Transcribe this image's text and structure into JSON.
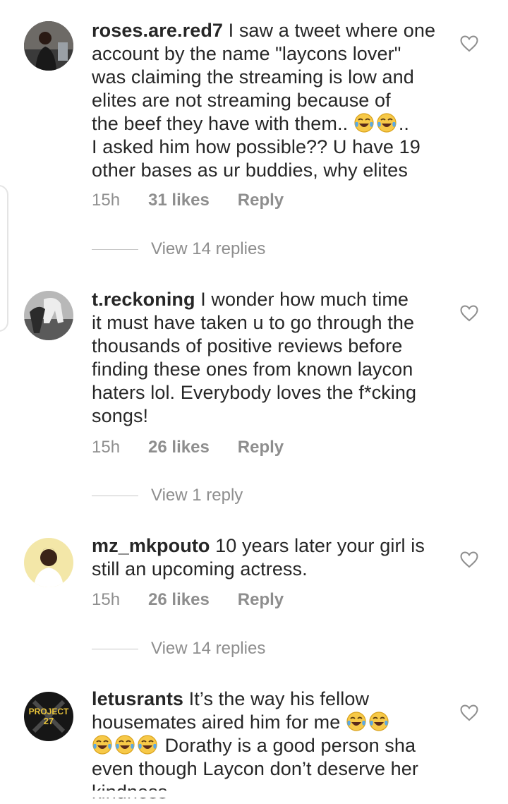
{
  "comments": [
    {
      "username": "roses.are.red7",
      "text_lines": [
        " I saw a tweet where one",
        "account by the name \"laycons lover\"",
        "was claiming the streaming is low and",
        "elites are not streaming because of",
        "the beef they have with them.. ",
        "I asked him how possible?? U have 19",
        "other bases as ur buddies, why elites"
      ],
      "text_after_emoji": "..",
      "time": "15h",
      "likes": "31 likes",
      "reply": "Reply",
      "view_replies": "View 14 replies"
    },
    {
      "username": "t.reckoning",
      "text_lines": [
        " I wonder how much time",
        "it must have taken u to go through the",
        "thousands of positive reviews before",
        "finding these ones from known laycon",
        "haters lol. Everybody loves the f*cking",
        "songs!"
      ],
      "time": "15h",
      "likes": "26 likes",
      "reply": "Reply",
      "view_replies": "View 1 reply"
    },
    {
      "username": "mz_mkpouto",
      "text_lines": [
        " 10 years later your girl is",
        "still an upcoming actress."
      ],
      "time": "15h",
      "likes": "26 likes",
      "reply": "Reply",
      "view_replies": "View 14 replies"
    },
    {
      "username": "letusrants",
      "text_lines": [
        " It’s the way his fellow",
        "housemates aired him for me ",
        " Dorathy is a good person sha",
        "even though Laycon don’t deserve her",
        "kindness"
      ],
      "avatar_text": [
        "PROJECT",
        "27"
      ]
    }
  ],
  "icons": {
    "like": "heart-outline-icon",
    "emoji": "face-with-tears-of-joy-emoji"
  },
  "colors": {
    "text": "#262626",
    "muted": "#8e8e8e",
    "divider": "#c7c7c7"
  }
}
